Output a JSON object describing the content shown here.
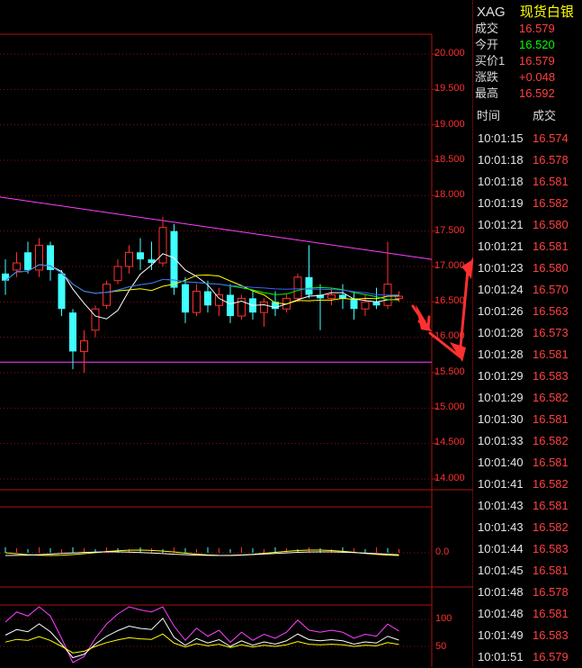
{
  "header": {
    "code": "XAG",
    "name": "现货白银"
  },
  "quote": [
    {
      "label": "成交",
      "value": "16.579",
      "color": "#ff4040"
    },
    {
      "label": "今开",
      "value": "16.520",
      "color": "#00ff00"
    },
    {
      "label": "买价1",
      "value": "16.579",
      "color": "#ff4040"
    },
    {
      "label": "涨跌",
      "value": "+0.048",
      "color": "#ff4040"
    },
    {
      "label": "最高",
      "value": "16.592",
      "color": "#ff4040"
    }
  ],
  "ticks_header": {
    "time": "时间",
    "price": "成交"
  },
  "ticks": [
    {
      "time": "10:01:15",
      "price": "16.574"
    },
    {
      "time": "10:01:18",
      "price": "16.578"
    },
    {
      "time": "10:01:18",
      "price": "16.581"
    },
    {
      "time": "10:01:19",
      "price": "16.582"
    },
    {
      "time": "10:01:21",
      "price": "16.580"
    },
    {
      "time": "10:01:21",
      "price": "16.581"
    },
    {
      "time": "10:01:23",
      "price": "16.580"
    },
    {
      "time": "10:01:24",
      "price": "16.570"
    },
    {
      "time": "10:01:26",
      "price": "16.563"
    },
    {
      "time": "10:01:28",
      "price": "16.573"
    },
    {
      "time": "10:01:28",
      "price": "16.581"
    },
    {
      "time": "10:01:29",
      "price": "16.583"
    },
    {
      "time": "10:01:29",
      "price": "16.582"
    },
    {
      "time": "10:01:30",
      "price": "16.581"
    },
    {
      "time": "10:01:33",
      "price": "16.582"
    },
    {
      "time": "10:01:40",
      "price": "16.581"
    },
    {
      "time": "10:01:41",
      "price": "16.582"
    },
    {
      "time": "10:01:43",
      "price": "16.581"
    },
    {
      "time": "10:01:43",
      "price": "16.582"
    },
    {
      "time": "10:01:44",
      "price": "16.583"
    },
    {
      "time": "10:01:45",
      "price": "16.581"
    },
    {
      "time": "10:01:48",
      "price": "16.578"
    },
    {
      "time": "10:01:48",
      "price": "16.581"
    },
    {
      "time": "10:01:49",
      "price": "16.583"
    },
    {
      "time": "10:01:51",
      "price": "16.579"
    }
  ],
  "main_axis": [
    "20.000",
    "19.500",
    "19.000",
    "18.500",
    "18.000",
    "17.500",
    "17.000",
    "16.500",
    "16.000",
    "15.500",
    "15.000",
    "14.500",
    "14.000"
  ],
  "macd_axis": [
    "0.0"
  ],
  "kdj_axis": [
    "100",
    "50"
  ],
  "colors": {
    "up": "#ff3030",
    "down": "#40ffff",
    "grid": "#8a1010",
    "trend": "#ff40ff"
  },
  "chart_data": {
    "type": "candlestick",
    "ylim": [
      14.0,
      20.0
    ],
    "candles": [
      {
        "o": 16.9,
        "h": 17.1,
        "l": 16.6,
        "c": 16.8
      },
      {
        "o": 16.95,
        "h": 17.2,
        "l": 16.85,
        "c": 17.05
      },
      {
        "o": 17.2,
        "h": 17.35,
        "l": 16.9,
        "c": 16.95
      },
      {
        "o": 16.95,
        "h": 17.4,
        "l": 16.85,
        "c": 17.3
      },
      {
        "o": 17.3,
        "h": 17.35,
        "l": 16.8,
        "c": 16.95
      },
      {
        "o": 16.9,
        "h": 16.95,
        "l": 16.3,
        "c": 16.4
      },
      {
        "o": 16.35,
        "h": 16.4,
        "l": 15.55,
        "c": 15.8
      },
      {
        "o": 15.8,
        "h": 16.1,
        "l": 15.5,
        "c": 15.95
      },
      {
        "o": 16.1,
        "h": 16.45,
        "l": 16.0,
        "c": 16.4
      },
      {
        "o": 16.45,
        "h": 16.8,
        "l": 16.4,
        "c": 16.75
      },
      {
        "o": 16.8,
        "h": 17.1,
        "l": 16.75,
        "c": 17.0
      },
      {
        "o": 17.0,
        "h": 17.3,
        "l": 16.9,
        "c": 17.2
      },
      {
        "o": 17.2,
        "h": 17.4,
        "l": 16.95,
        "c": 17.1
      },
      {
        "o": 17.1,
        "h": 17.35,
        "l": 16.95,
        "c": 17.05
      },
      {
        "o": 17.05,
        "h": 17.7,
        "l": 17.0,
        "c": 17.55
      },
      {
        "o": 17.5,
        "h": 17.6,
        "l": 16.6,
        "c": 16.7
      },
      {
        "o": 16.75,
        "h": 16.85,
        "l": 16.2,
        "c": 16.35
      },
      {
        "o": 16.35,
        "h": 16.75,
        "l": 16.3,
        "c": 16.65
      },
      {
        "o": 16.65,
        "h": 16.8,
        "l": 16.35,
        "c": 16.45
      },
      {
        "o": 16.45,
        "h": 16.7,
        "l": 16.3,
        "c": 16.6
      },
      {
        "o": 16.6,
        "h": 16.75,
        "l": 16.2,
        "c": 16.3
      },
      {
        "o": 16.3,
        "h": 16.6,
        "l": 16.25,
        "c": 16.55
      },
      {
        "o": 16.55,
        "h": 16.65,
        "l": 16.25,
        "c": 16.35
      },
      {
        "o": 16.35,
        "h": 16.55,
        "l": 16.15,
        "c": 16.5
      },
      {
        "o": 16.5,
        "h": 16.65,
        "l": 16.3,
        "c": 16.4
      },
      {
        "o": 16.4,
        "h": 16.6,
        "l": 16.35,
        "c": 16.55
      },
      {
        "o": 16.55,
        "h": 16.9,
        "l": 16.5,
        "c": 16.85
      },
      {
        "o": 16.85,
        "h": 17.3,
        "l": 16.55,
        "c": 16.6
      },
      {
        "o": 16.6,
        "h": 16.75,
        "l": 16.1,
        "c": 16.55
      },
      {
        "o": 16.55,
        "h": 16.7,
        "l": 16.45,
        "c": 16.6
      },
      {
        "o": 16.6,
        "h": 16.75,
        "l": 16.4,
        "c": 16.55
      },
      {
        "o": 16.55,
        "h": 16.65,
        "l": 16.25,
        "c": 16.4
      },
      {
        "o": 16.4,
        "h": 16.6,
        "l": 16.3,
        "c": 16.5
      },
      {
        "o": 16.5,
        "h": 16.7,
        "l": 16.4,
        "c": 16.45
      },
      {
        "o": 16.45,
        "h": 17.35,
        "l": 16.4,
        "c": 16.75
      },
      {
        "o": 16.55,
        "h": 16.65,
        "l": 16.5,
        "c": 16.58
      }
    ]
  }
}
